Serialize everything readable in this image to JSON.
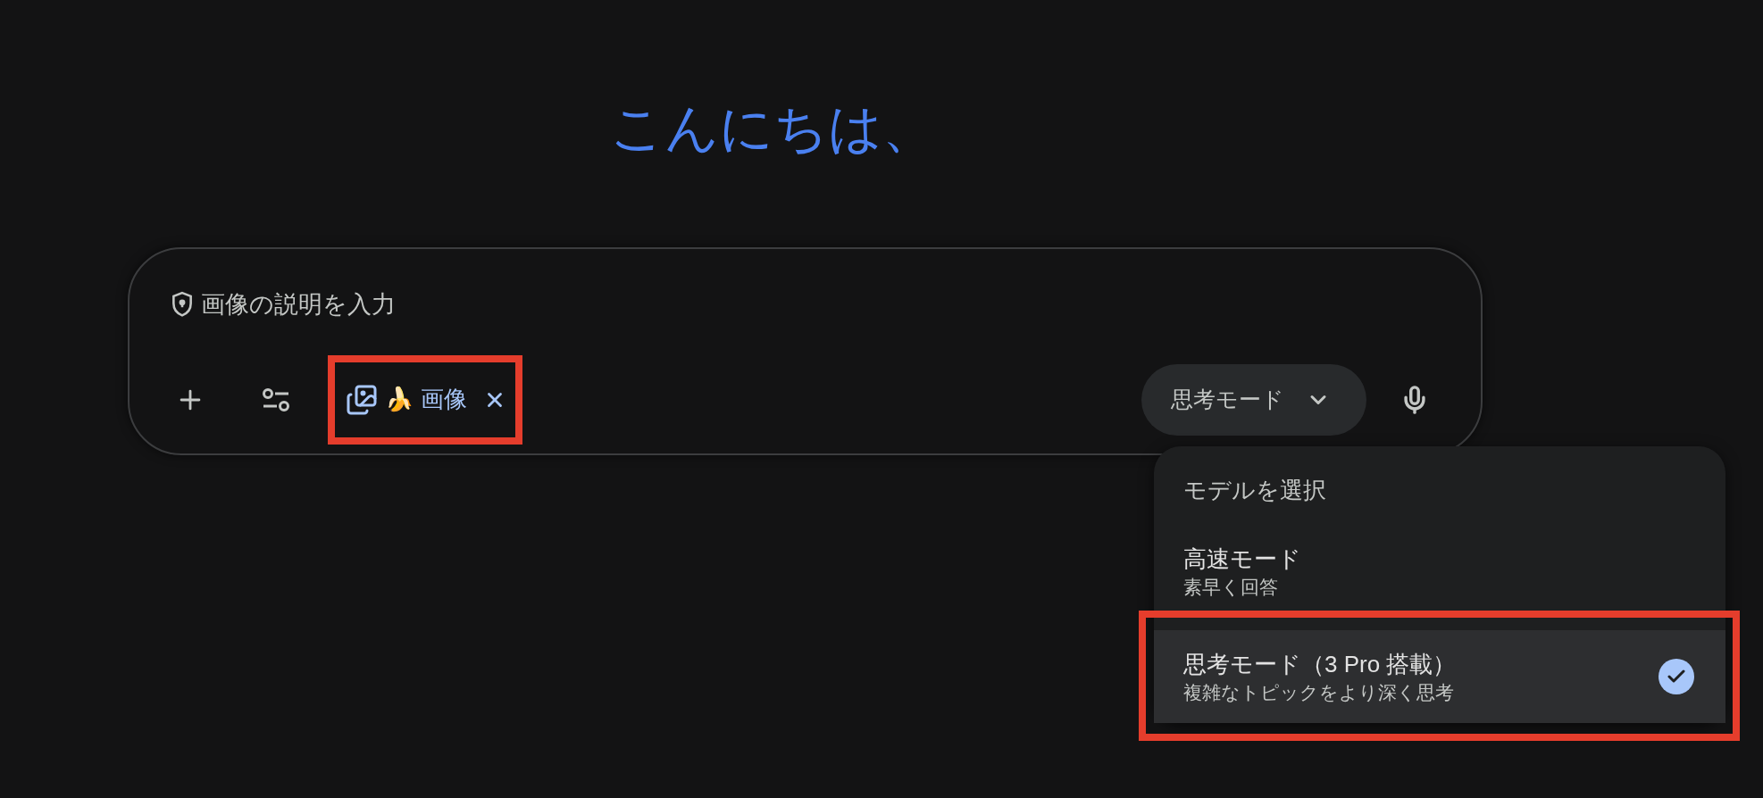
{
  "greeting": "こんにちは、",
  "prompt": {
    "placeholder": "画像の説明を入力"
  },
  "tool_chip": {
    "emoji": "🍌",
    "label": "画像",
    "highlighted": true
  },
  "mode_button": {
    "label": "思考モード",
    "expanded": true
  },
  "model_menu": {
    "title": "モデルを選択",
    "options": [
      {
        "label": "高速モード",
        "description": "素早く回答",
        "selected": false,
        "highlighted": false
      },
      {
        "label": "思考モード（3 Pro 搭載）",
        "description": "複雑なトピックをより深く思考",
        "selected": true,
        "highlighted": true
      }
    ]
  }
}
